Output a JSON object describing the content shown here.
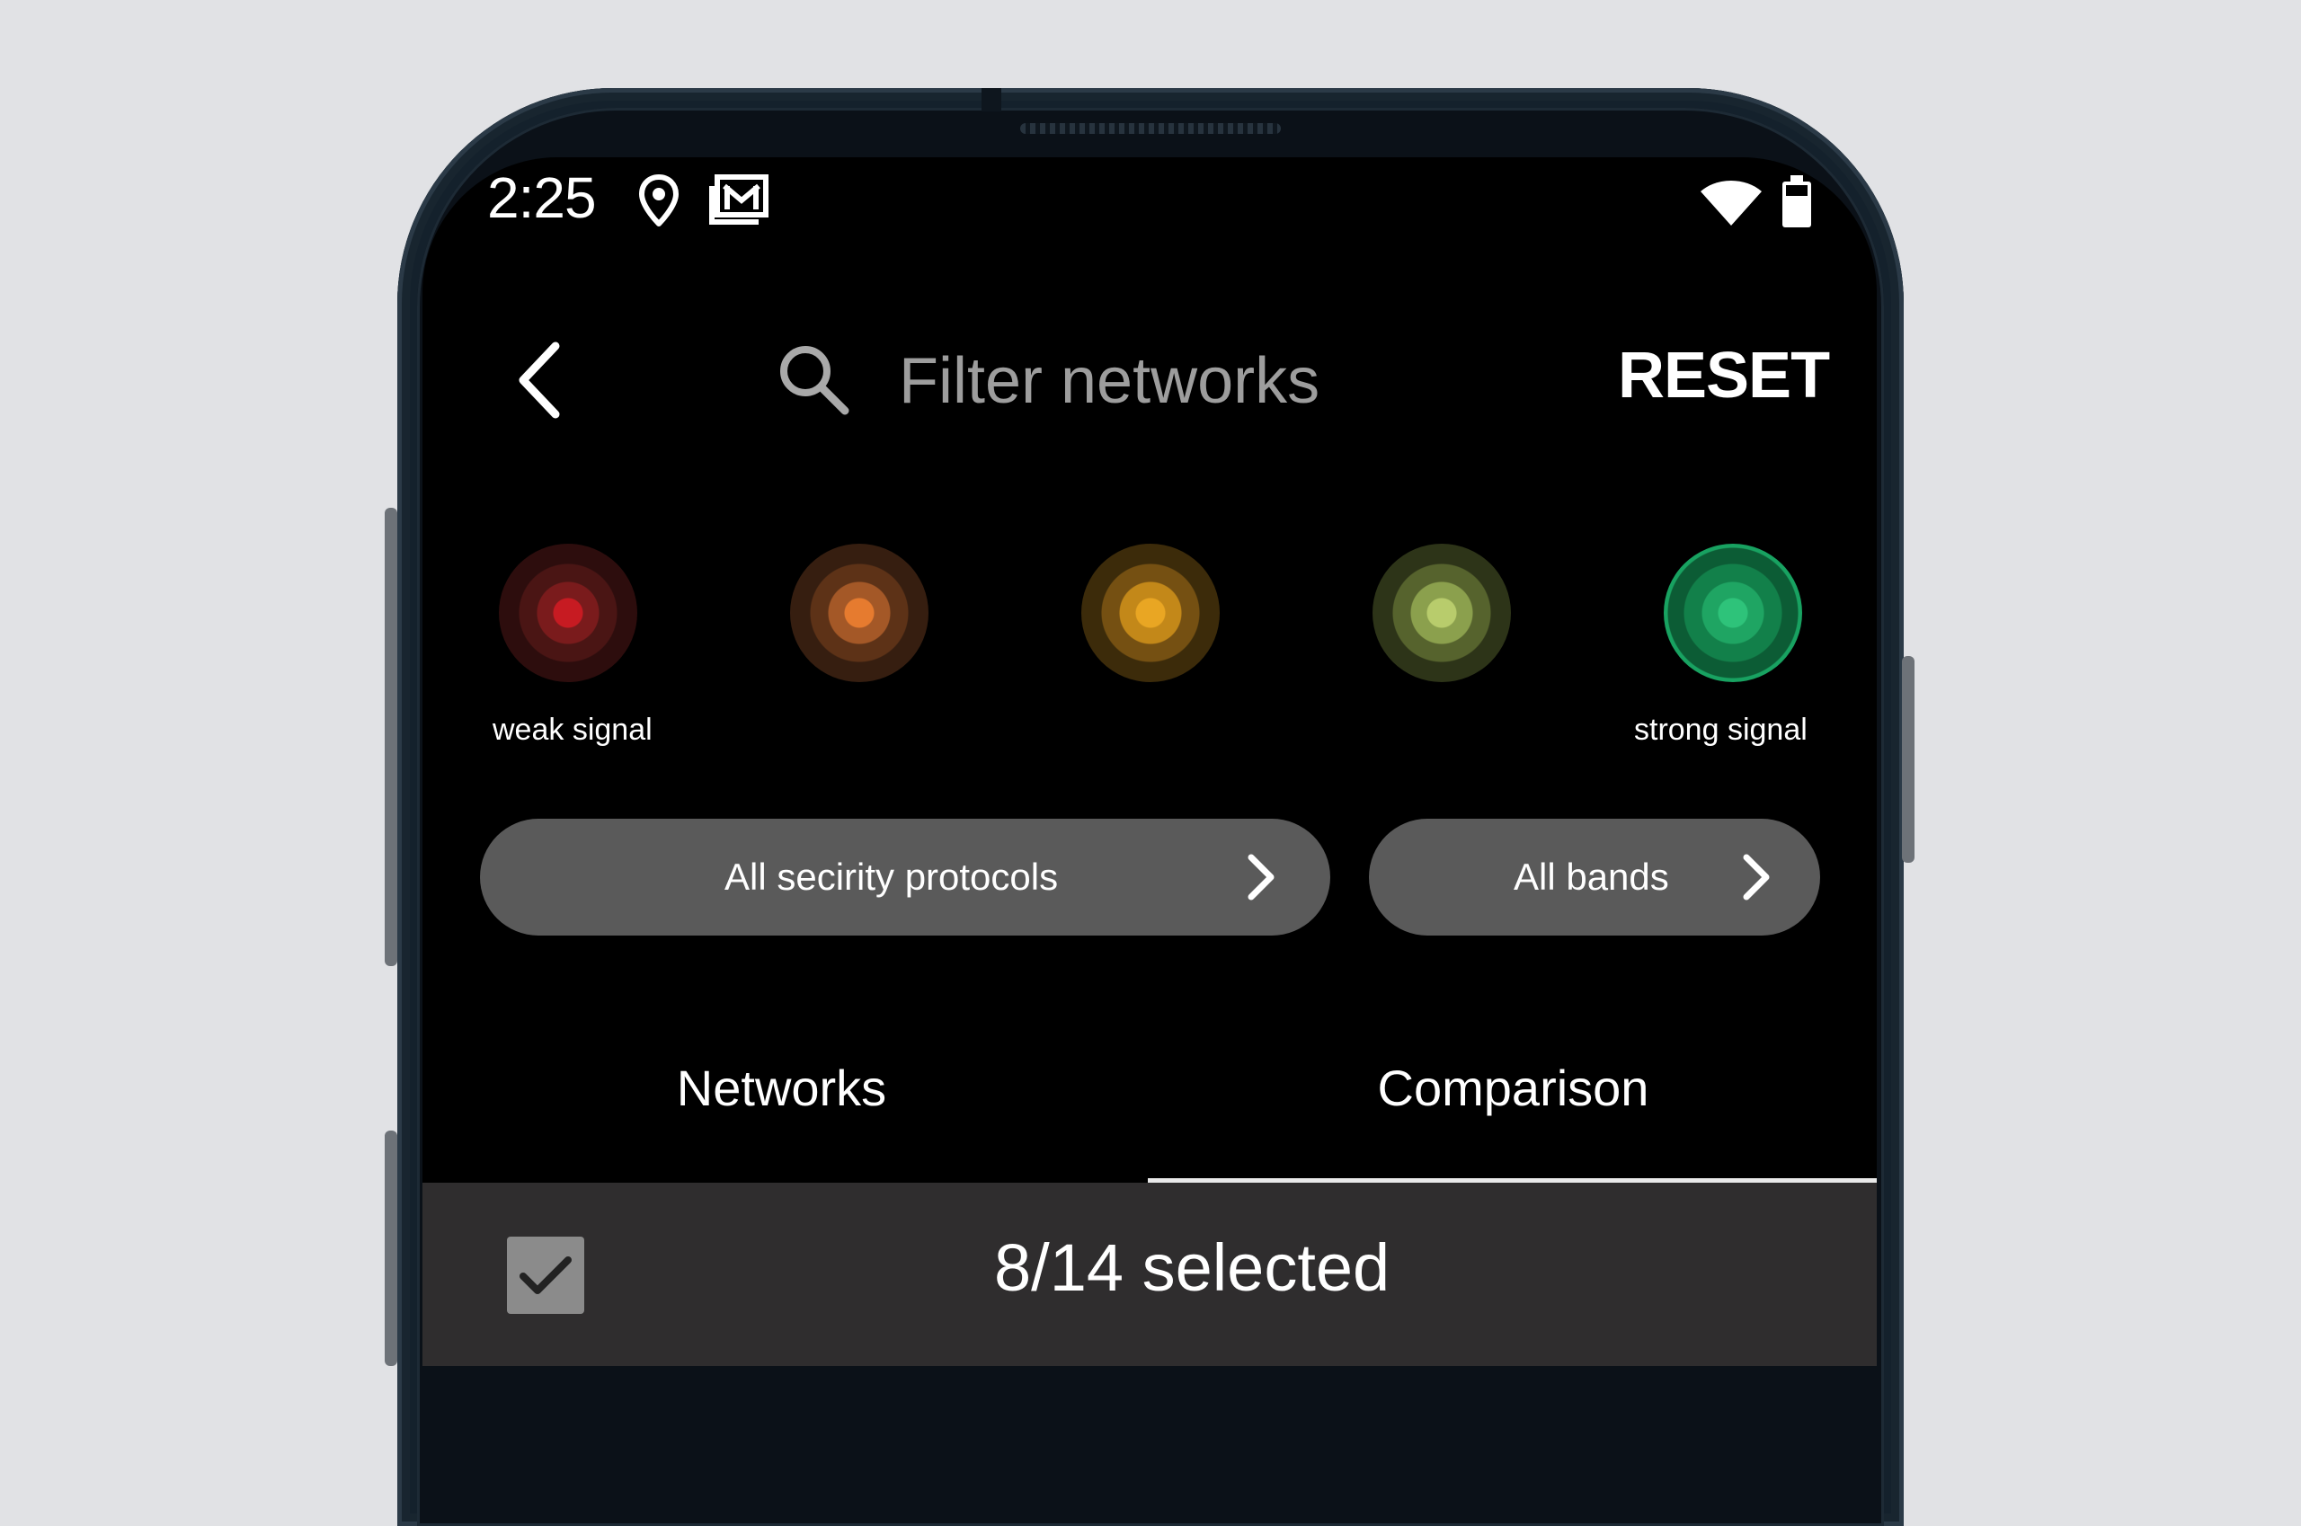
{
  "status_bar": {
    "time": "2:25",
    "icons": [
      "location-icon",
      "mail-icon",
      "wifi-icon",
      "battery-icon"
    ]
  },
  "toolbar": {
    "back_icon": "back-chevron-icon",
    "search_icon": "search-icon",
    "search_value": "",
    "search_placeholder": "Filter networks",
    "reset_label": "RESET"
  },
  "signal_filter": {
    "levels": [
      {
        "color": "#c71b22"
      },
      {
        "color": "#e67b2f"
      },
      {
        "color": "#e9a623"
      },
      {
        "color": "#b8cc6c"
      },
      {
        "color": "#2ec37a",
        "selected": true
      }
    ],
    "weak_label": "weak signal",
    "strong_label": "strong signal"
  },
  "filters": {
    "security_label": "All secirity protocols",
    "bands_label": "All bands"
  },
  "tabs": {
    "items": [
      {
        "label": "Networks",
        "active": false
      },
      {
        "label": "Comparison",
        "active": true
      }
    ]
  },
  "selection": {
    "checked": true,
    "label": "8/14 selected"
  },
  "colors": {
    "background": "#000000",
    "pill": "#5a5a5a",
    "selection_bar": "#2f2d2e",
    "tab_indicator": "#e9e9e9"
  }
}
